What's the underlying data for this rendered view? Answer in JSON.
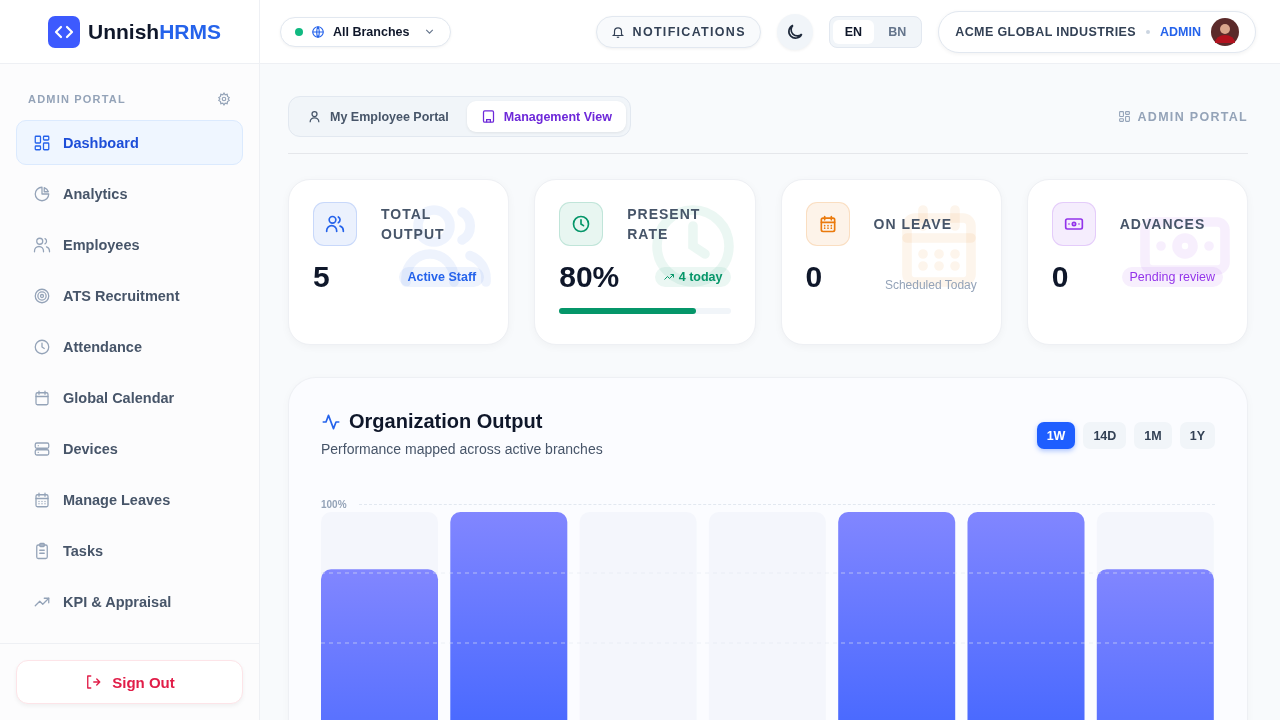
{
  "brand": {
    "name": "Unnish",
    "suffix": "HRMS"
  },
  "header": {
    "branch": {
      "label": "All Branches",
      "online": true
    },
    "notifications": "NOTIFICATIONS",
    "languages": [
      {
        "label": "EN",
        "selected": true
      },
      {
        "label": "BN",
        "selected": false
      }
    ],
    "company": "ACME GLOBAL INDUSTRIES",
    "role": "ADMIN"
  },
  "sidebar": {
    "section": "ADMIN PORTAL",
    "items": [
      {
        "label": "Dashboard",
        "selected": true
      },
      {
        "label": "Analytics",
        "selected": false
      },
      {
        "label": "Employees",
        "selected": false
      },
      {
        "label": "ATS Recruitment",
        "selected": false
      },
      {
        "label": "Attendance",
        "selected": false
      },
      {
        "label": "Global Calendar",
        "selected": false
      },
      {
        "label": "Devices",
        "selected": false
      },
      {
        "label": "Manage Leaves",
        "selected": false
      },
      {
        "label": "Tasks",
        "selected": false
      },
      {
        "label": "KPI & Appraisal",
        "selected": false
      }
    ],
    "sign_out": "Sign Out"
  },
  "views": [
    {
      "label": "My Employee Portal",
      "selected": false
    },
    {
      "label": "Management View",
      "selected": true
    }
  ],
  "portal_label": "ADMIN PORTAL",
  "cards": [
    {
      "title": "TOTAL OUTPUT",
      "value": "5",
      "color": "#2563eb",
      "note": {
        "kind": "badge",
        "text": "Active Staff"
      }
    },
    {
      "title": "PRESENT RATE",
      "value": "80%",
      "color": "#059669",
      "note": {
        "kind": "trend",
        "text": "4 today"
      },
      "level": 0.8
    },
    {
      "title": "ON LEAVE",
      "value": "0",
      "color": "#ea7a0c",
      "note": {
        "kind": "text",
        "text": "Scheduled Today"
      }
    },
    {
      "title": "ADVANCES",
      "value": "0",
      "color": "#9333ea",
      "note": {
        "kind": "badge",
        "text": "Pending review"
      }
    }
  ],
  "output": {
    "title": "Organization Output",
    "subtitle": "Performance mapped across active branches",
    "ranges": [
      {
        "label": "1W",
        "selected": true
      },
      {
        "label": "14D",
        "selected": false
      },
      {
        "label": "1M",
        "selected": false
      },
      {
        "label": "1Y",
        "selected": false
      }
    ],
    "top_tick": "100%"
  }
}
